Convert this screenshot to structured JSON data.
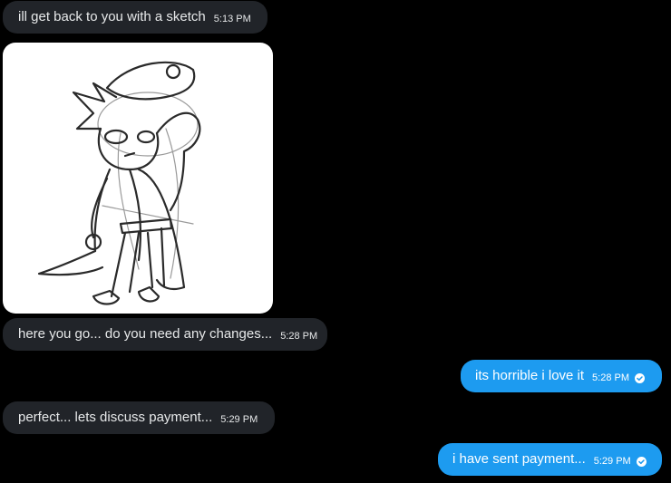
{
  "messages": [
    {
      "text": "ill get back to you with a sketch",
      "time": "5:13 PM",
      "side": "received"
    },
    {
      "text": "here you go... do you need any changes...",
      "time": "5:28 PM",
      "side": "received"
    },
    {
      "text": "its horrible i love it",
      "time": "5:28 PM",
      "side": "sent"
    },
    {
      "text": "perfect... lets discuss payment...",
      "time": "5:29 PM",
      "side": "received"
    },
    {
      "text": "i have sent payment...",
      "time": "5:29 PM",
      "side": "sent"
    }
  ],
  "attachment": {
    "type": "image",
    "description_icon": "sketch-drawing"
  },
  "colors": {
    "background": "#000000",
    "received_bubble": "#212429",
    "sent_bubble": "#1d9bf0",
    "text": "#e7e9ea"
  }
}
